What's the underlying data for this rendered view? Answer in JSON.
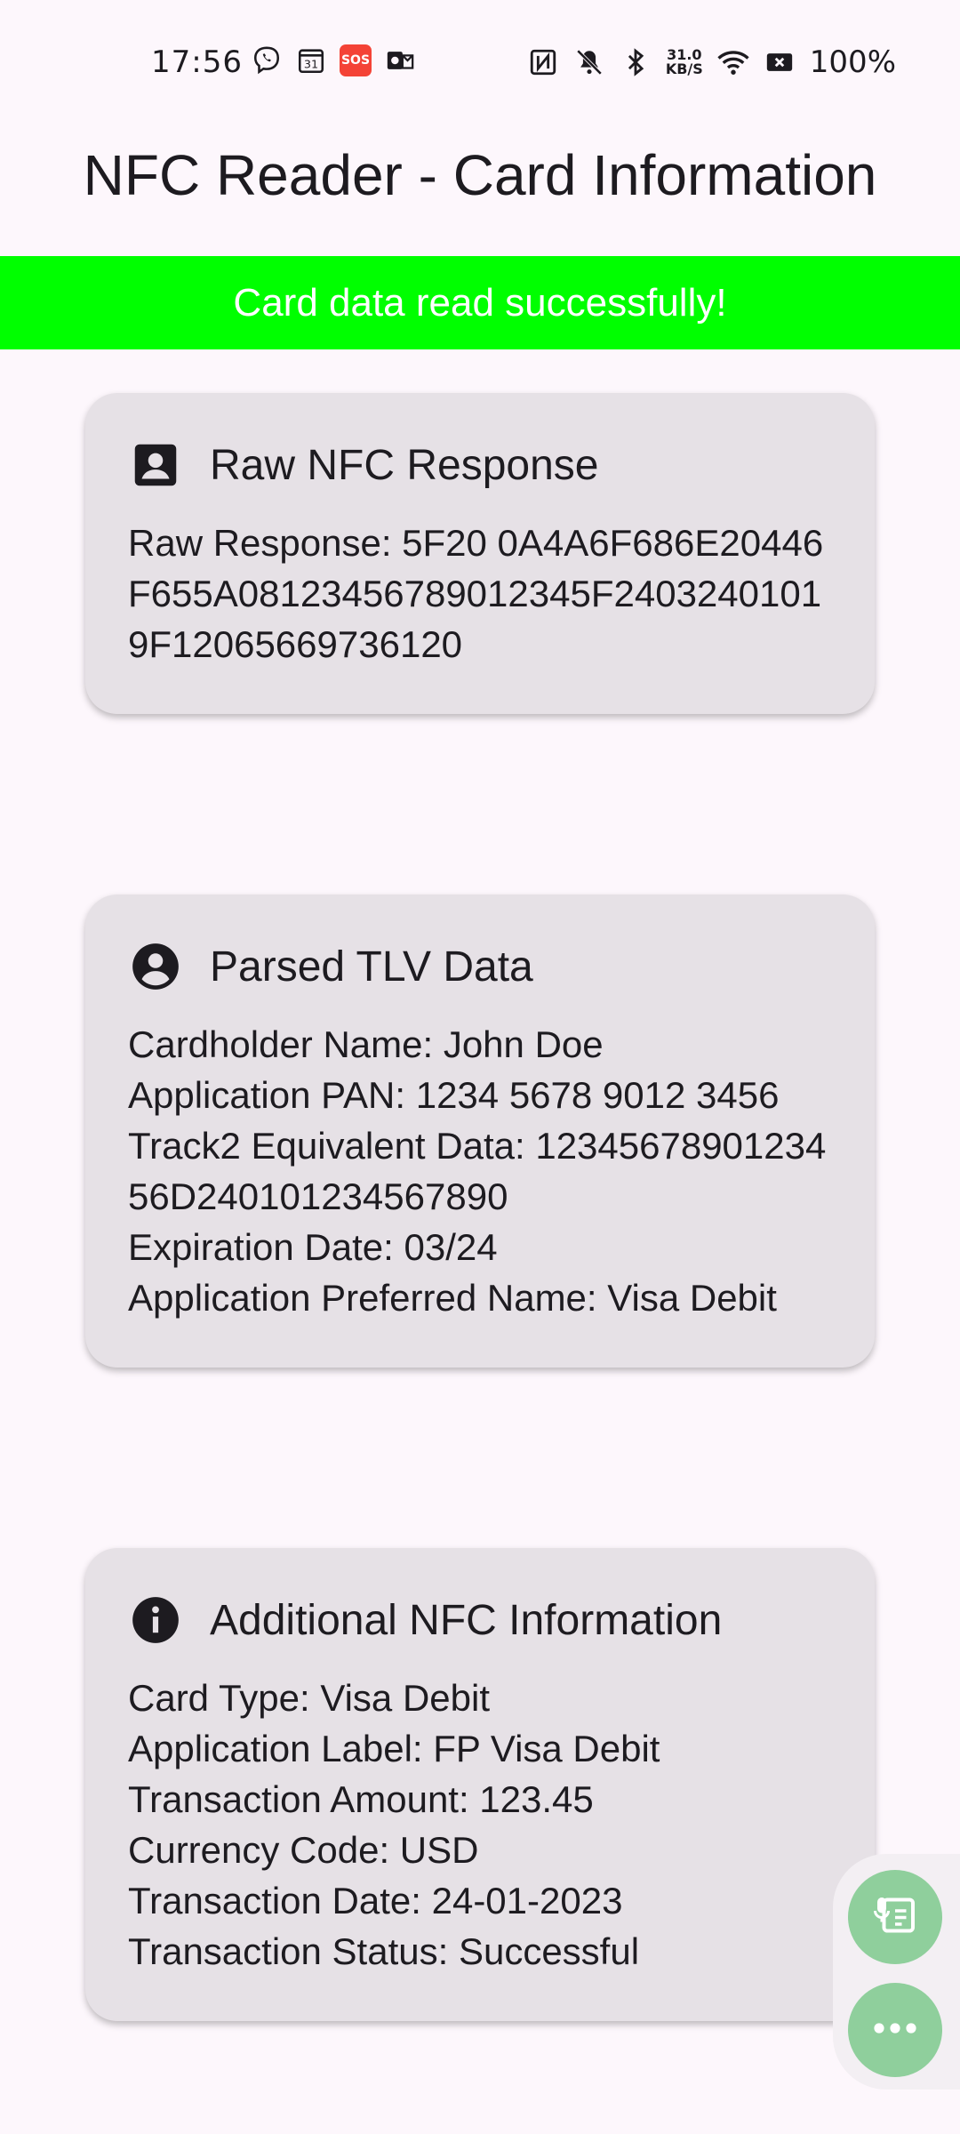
{
  "status_bar": {
    "time": "17:56",
    "network_speed_value": "31.0",
    "network_speed_unit": "KB/S",
    "battery": "100%",
    "icons": [
      "viber-icon",
      "calendar-31-icon",
      "sos-icon",
      "outlook-icon",
      "nfc-icon",
      "mute-icon",
      "bluetooth-icon",
      "wifi-icon",
      "no-sim-icon"
    ],
    "calendar_day": "31",
    "sos_label": "SOS"
  },
  "app": {
    "title": "NFC Reader - Card Information",
    "banner": "Card data read successfully!",
    "banner_color": "#00ff00"
  },
  "cards": {
    "raw": {
      "icon": "contact-card-icon",
      "title": "Raw NFC Response",
      "line1": "Raw Response: 5F20 0A4A6F686E20446F655A08123456789012345F24032401019F12065669736120"
    },
    "tlv": {
      "icon": "account-circle-icon",
      "title": "Parsed TLV Data",
      "cardholder": "Cardholder Name: John Doe",
      "pan": "Application PAN: 1234 5678 9012 3456",
      "track2": "Track2 Equivalent Data: 1234567890123456D240101234567890",
      "expiry": "Expiration Date: 03/24",
      "preferred_name": "Application Preferred Name: Visa Debit"
    },
    "extra": {
      "icon": "info-icon",
      "title": "Additional NFC Information",
      "card_type": "Card Type: Visa Debit",
      "app_label": "Application Label: FP Visa Debit",
      "amount": "Transaction Amount: 123.45",
      "currency": "Currency Code: USD",
      "date": "Transaction Date: 24-01-2023",
      "status": "Transaction Status: Successful"
    }
  },
  "floating": {
    "buttons": [
      "voice-notes-icon",
      "more-icon"
    ],
    "color": "#8fcf9c"
  }
}
